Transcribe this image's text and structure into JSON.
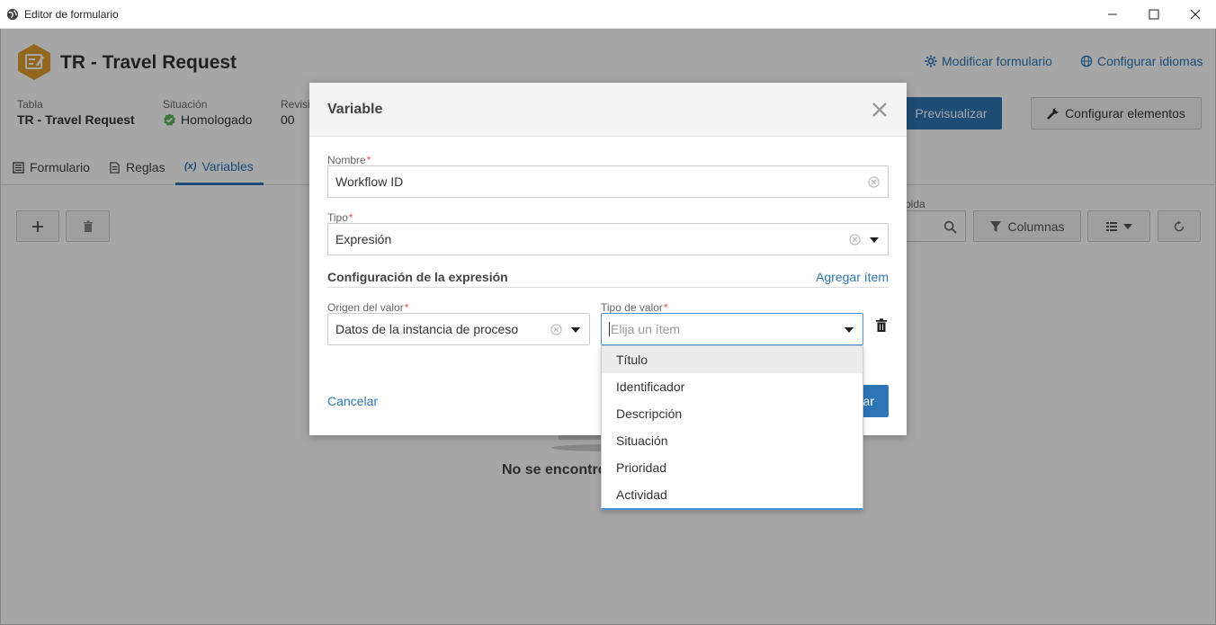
{
  "window": {
    "title": "Editor de formulario"
  },
  "header": {
    "title": "TR - Travel Request",
    "links": {
      "modify_form": "Modificar formulario",
      "configure_languages": "Configurar idiomas"
    }
  },
  "meta": {
    "table_label": "Tabla",
    "table_value": "TR - Travel Request",
    "status_label": "Situación",
    "status_value": "Homologado",
    "revision_label": "Revisi",
    "revision_value": "00"
  },
  "actions": {
    "preview": "Previsualizar",
    "configure_elements": "Configurar elementos"
  },
  "tabs": [
    {
      "label": "Formulario",
      "icon": "form-icon"
    },
    {
      "label": "Reglas",
      "icon": "rules-icon"
    },
    {
      "label": "Variables",
      "icon": "variables-icon",
      "active": true
    }
  ],
  "toolbar": {
    "search_label": "pida",
    "columns": "Columnas"
  },
  "empty_state": {
    "text": "No se encontro"
  },
  "modal": {
    "title": "Variable",
    "fields": {
      "name_label": "Nombre",
      "name_value": "Workflow ID",
      "type_label": "Tipo",
      "type_value": "Expresión"
    },
    "section": {
      "title": "Configuración de la expresión",
      "add_item": "Agregar ítem"
    },
    "expression": {
      "origin_label": "Origen del valor",
      "origin_value": "Datos de la instancia de proceso",
      "value_type_label": "Tipo de valor",
      "value_type_placeholder": "Elija un ítem"
    },
    "footer": {
      "cancel": "Cancelar",
      "save_partial": "ar"
    }
  },
  "dropdown": {
    "options": [
      "Título",
      "Identificador",
      "Descripción",
      "Situación",
      "Prioridad",
      "Actividad"
    ],
    "hover_index": 0
  },
  "colors": {
    "accent": "#2d75b5",
    "required": "#d9534f",
    "logo": "#e0a030",
    "status_ok": "#5cb85c"
  }
}
